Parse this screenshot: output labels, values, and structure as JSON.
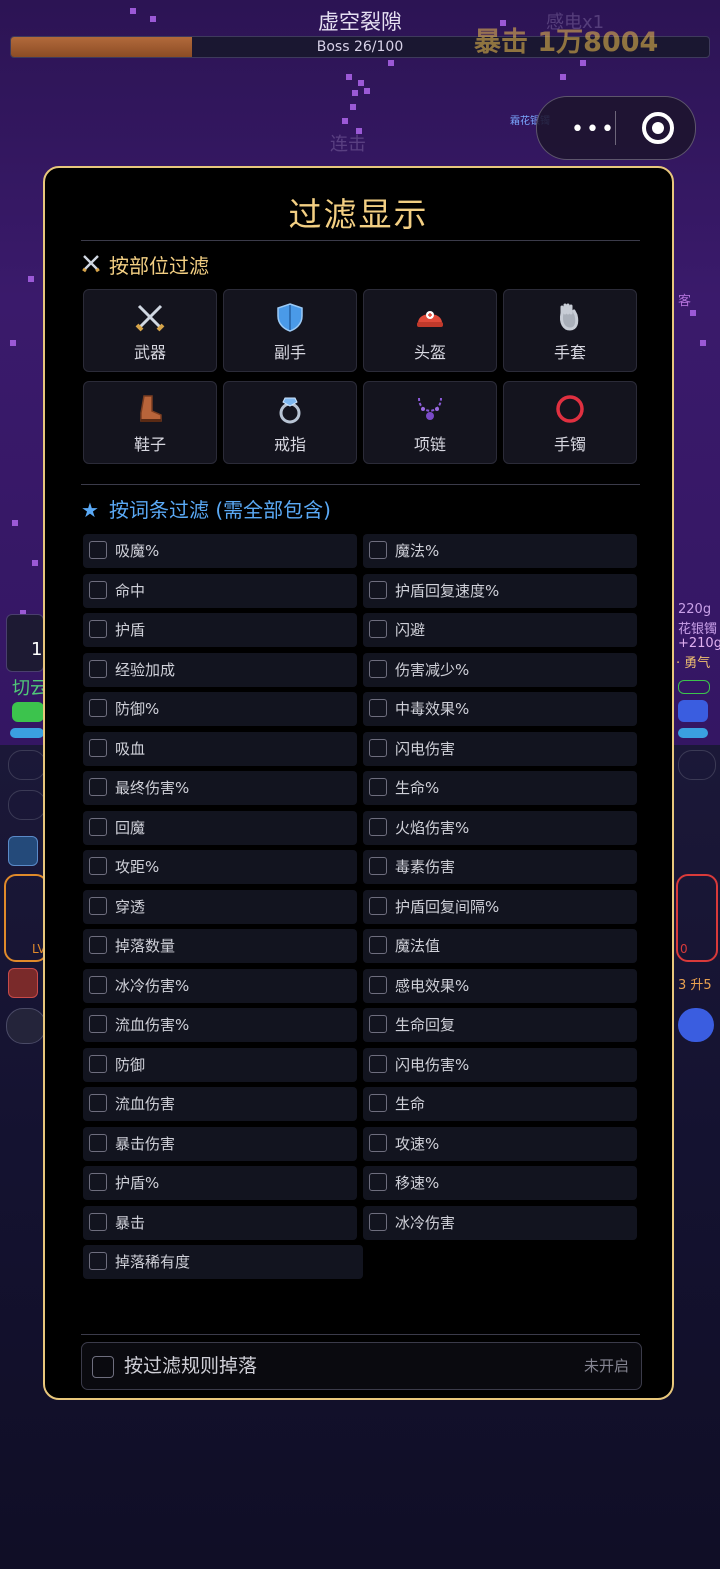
{
  "game": {
    "stage_title": "虚空裂隙",
    "boss_progress_text": "Boss 26/100",
    "boss_progress_fraction": 0.26,
    "crit_popup": "暴击 1万8004",
    "faded_popup": "感电x1",
    "faded_combo": "连击",
    "drop_item_label": "霜花银镯",
    "left_partial_label": "切云",
    "right_partial_lines": [
      "220g",
      "花银镯",
      "+210g",
      "· 勇气"
    ],
    "right_partial_small": "客",
    "lv_partial": "LV",
    "zero_partial": "0",
    "upgrade_partial": "3 升5",
    "left_num_partial": "1"
  },
  "menu_capsule": {
    "more_icon": "more-dots-icon",
    "close_icon": "target-icon"
  },
  "modal": {
    "title": "过滤显示",
    "slot_section": {
      "icon": "crossed-swords-icon",
      "title": "按部位过滤"
    },
    "slots": [
      {
        "label": "武器",
        "icon": "crossed-swords-icon"
      },
      {
        "label": "副手",
        "icon": "shield-icon"
      },
      {
        "label": "头盔",
        "icon": "helmet-icon"
      },
      {
        "label": "手套",
        "icon": "gloves-icon"
      },
      {
        "label": "鞋子",
        "icon": "boot-icon"
      },
      {
        "label": "戒指",
        "icon": "ring-icon"
      },
      {
        "label": "项链",
        "icon": "necklace-icon"
      },
      {
        "label": "手镯",
        "icon": "bracelet-icon"
      }
    ],
    "affix_section": {
      "icon": "star-icon",
      "title": "按词条过滤 (需全部包含)"
    },
    "affixes": [
      {
        "label": "吸魔%",
        "checked": false
      },
      {
        "label": "魔法%",
        "checked": false
      },
      {
        "label": "命中",
        "checked": false
      },
      {
        "label": "护盾回复速度%",
        "checked": false
      },
      {
        "label": "护盾",
        "checked": false
      },
      {
        "label": "闪避",
        "checked": false
      },
      {
        "label": "经验加成",
        "checked": false
      },
      {
        "label": "伤害减少%",
        "checked": false
      },
      {
        "label": "防御%",
        "checked": false
      },
      {
        "label": "中毒效果%",
        "checked": false
      },
      {
        "label": "吸血",
        "checked": false
      },
      {
        "label": "闪电伤害",
        "checked": false
      },
      {
        "label": "最终伤害%",
        "checked": false
      },
      {
        "label": "生命%",
        "checked": false
      },
      {
        "label": "回魔",
        "checked": false
      },
      {
        "label": "火焰伤害%",
        "checked": false
      },
      {
        "label": "攻距%",
        "checked": false
      },
      {
        "label": "毒素伤害",
        "checked": false
      },
      {
        "label": "穿透",
        "checked": false
      },
      {
        "label": "护盾回复间隔%",
        "checked": false
      },
      {
        "label": "掉落数量",
        "checked": false
      },
      {
        "label": "魔法值",
        "checked": false
      },
      {
        "label": "冰冷伤害%",
        "checked": false
      },
      {
        "label": "感电效果%",
        "checked": false
      },
      {
        "label": "流血伤害%",
        "checked": false
      },
      {
        "label": "生命回复",
        "checked": false
      },
      {
        "label": "防御",
        "checked": false
      },
      {
        "label": "闪电伤害%",
        "checked": false
      },
      {
        "label": "流血伤害",
        "checked": false
      },
      {
        "label": "生命",
        "checked": false
      },
      {
        "label": "暴击伤害",
        "checked": false
      },
      {
        "label": "攻速%",
        "checked": false
      },
      {
        "label": "护盾%",
        "checked": false
      },
      {
        "label": "移速%",
        "checked": false
      },
      {
        "label": "暴击",
        "checked": false
      },
      {
        "label": "冰冷伤害",
        "checked": false
      },
      {
        "label": "掉落稀有度",
        "checked": false
      }
    ],
    "footer": {
      "label": "按过滤规则掉落",
      "status": "未开启",
      "checked": false
    }
  },
  "colors": {
    "accent": "#f3cf83",
    "affix_header": "#5aa9f5",
    "modal_border": "#e8c77c"
  }
}
